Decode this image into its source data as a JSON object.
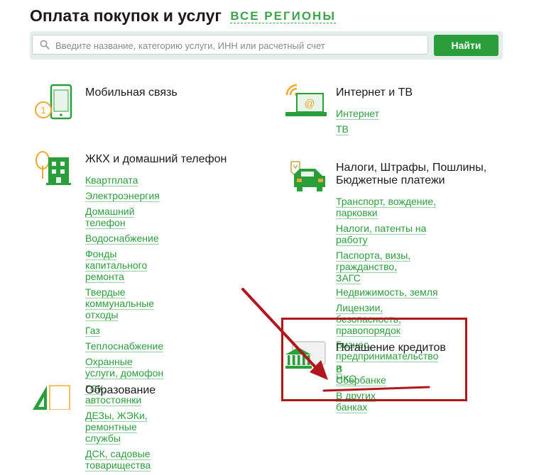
{
  "page": {
    "title": "Оплата покупок и услуг",
    "region_link": "ВСЕ РЕГИОНЫ"
  },
  "search": {
    "placeholder": "Введите название, категорию услуги, ИНН или расчетный счет",
    "value": "",
    "button_label": "Найти"
  },
  "categories": {
    "mobile": {
      "title": "Мобильная связь",
      "links": []
    },
    "internet": {
      "title": "Интернет и ТВ",
      "links": [
        "Интернет",
        "ТВ"
      ]
    },
    "housing": {
      "title": "ЖКХ и домашний телефон",
      "links": [
        "Квартплата",
        "Электроэнергия",
        "Домашний телефон",
        "Водоснабжение",
        "Фонды капитального ремонта",
        "Твердые коммунальные отходы",
        "Газ",
        "Теплоснабжение",
        "Охранные услуги, домофон",
        "ГСК, автостоянки",
        "ДЕЗы, ЖЭКи, ремонтные службы",
        "ДСК, садовые товарищества"
      ]
    },
    "taxes": {
      "title_line1": "Налоги, Штрафы, Пошлины,",
      "title_line2": "Бюджетные платежи",
      "links": [
        {
          "l1": "Транспорт, вождение, парковки",
          "l2": ""
        },
        {
          "l1": "Налоги, патенты на работу",
          "l2": ""
        },
        {
          "l1": "Паспорта, визы, гражданство,",
          "l2": "ЗАГС"
        },
        {
          "l1": "Недвижимость, земля",
          "l2": ""
        },
        {
          "l1": "Лицензии, безопасность,",
          "l2": "правопорядок"
        },
        {
          "l1": "Бизнес, предпринимательство и",
          "l2": "НКО"
        }
      ]
    },
    "loans": {
      "title": "Погашение кредитов",
      "links": [
        "В Сбербанке",
        "В других банках"
      ]
    },
    "education": {
      "title": "Образование"
    }
  },
  "colors": {
    "accent": "#2a9e3a",
    "link": "#2f9a3f",
    "icon_orange": "#f0a830",
    "annotation_red": "#b0171d"
  },
  "icons": [
    "search-icon",
    "mobile-phone-icon",
    "laptop-wifi-icon",
    "house-tree-icon",
    "car-coat-of-arms-icon",
    "bank-wallet-icon",
    "education-icon"
  ]
}
